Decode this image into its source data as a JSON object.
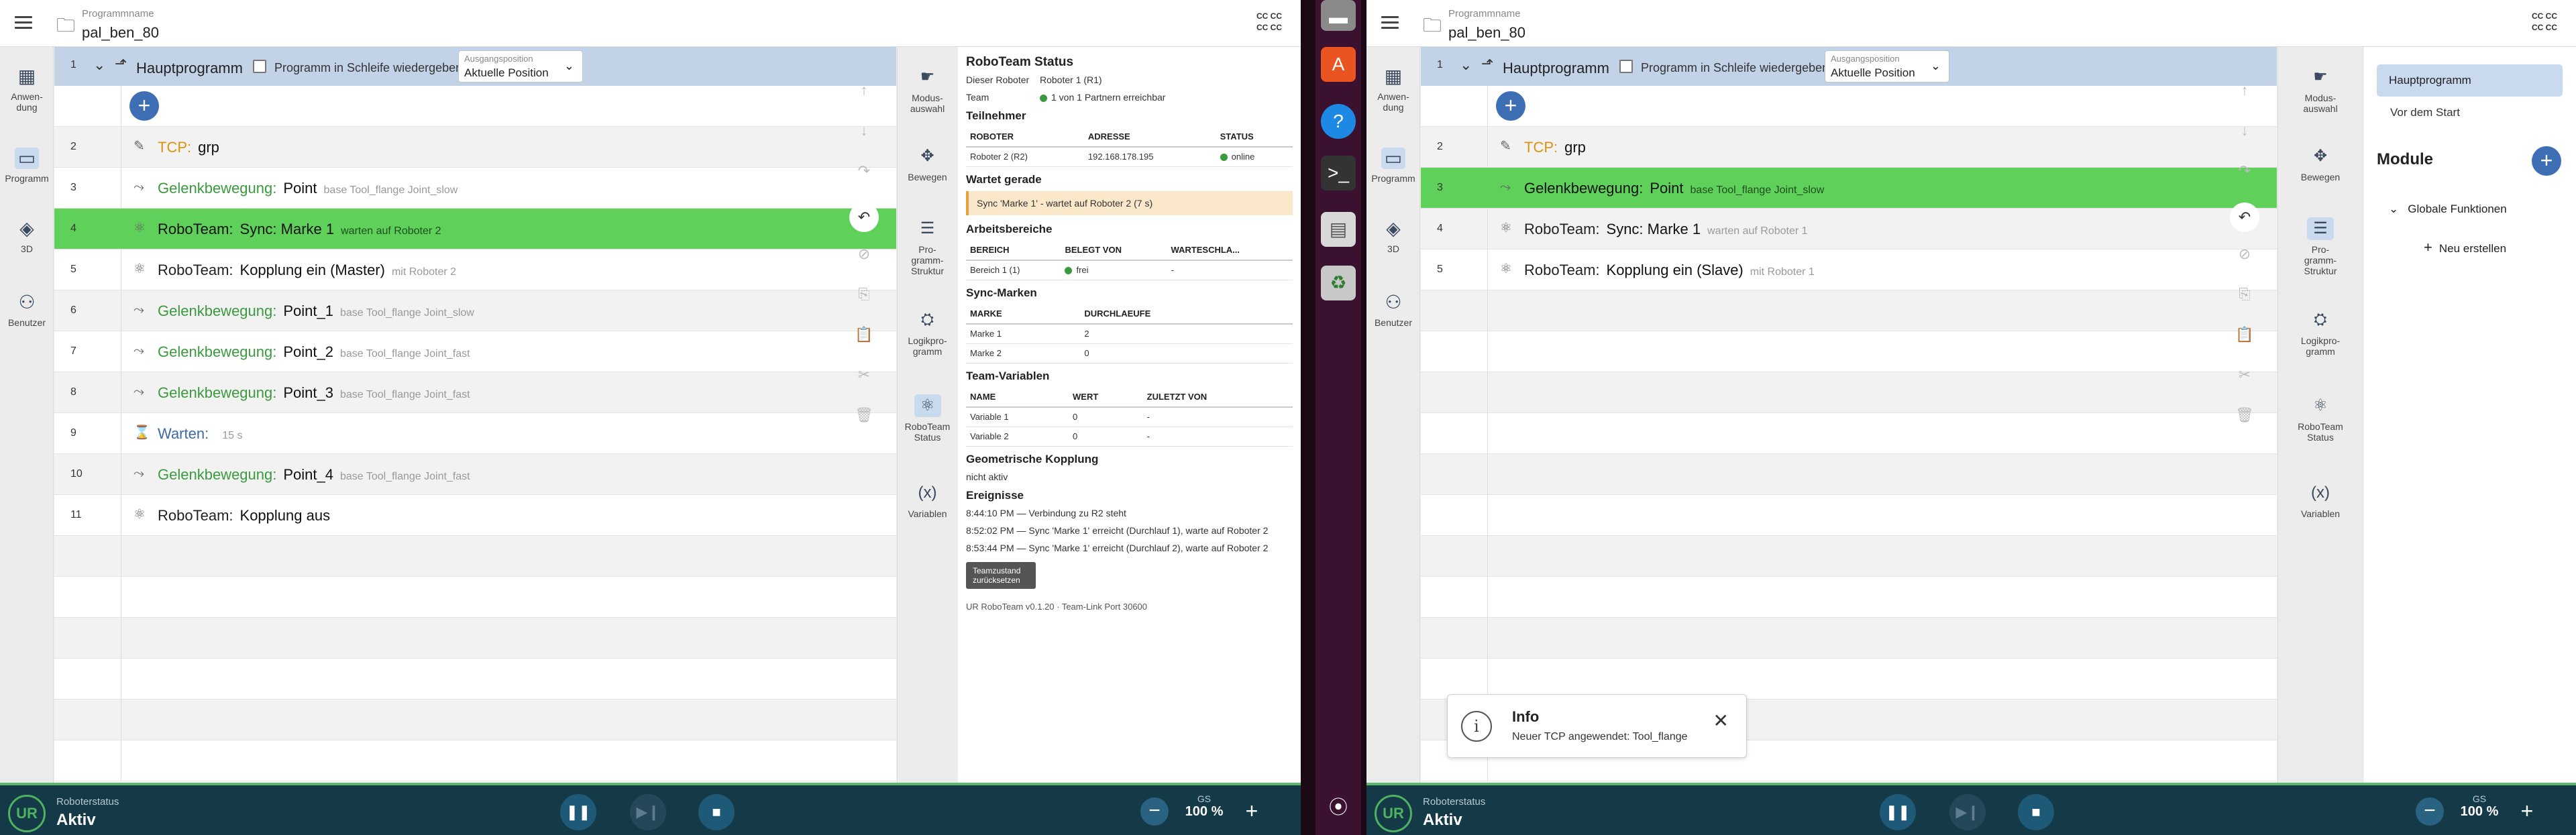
{
  "left": {
    "header": {
      "program_label": "Programmname",
      "program_name": "pal_ben_80",
      "cc": [
        "CC CC",
        "CC CC"
      ]
    },
    "nav": [
      {
        "label": "Anwen-\ndung",
        "icon": "apps-icon"
      },
      {
        "label": "Programm",
        "icon": "program-icon",
        "active": true
      },
      {
        "label": "3D",
        "icon": "cube-icon"
      },
      {
        "label": "Benutzer",
        "icon": "user-icon"
      }
    ],
    "program": {
      "num": "1",
      "title": "Hauptprogramm",
      "loop_label": "Programm in Schleife wiedergeben",
      "start_label": "Ausgangsposition",
      "start_value": "Aktuelle Position"
    },
    "rows": [
      {
        "n": "2",
        "kw": "TCP:",
        "name": "grp",
        "params": "",
        "color": "orange",
        "icon": "tcp-icon"
      },
      {
        "n": "3",
        "kw": "Gelenkbewegung:",
        "name": "Point",
        "params": "base   Tool_flange   Joint_slow",
        "color": "green",
        "icon": "move-icon"
      },
      {
        "n": "4",
        "kw": "RoboTeam:",
        "name": "Sync: Marke 1",
        "params": "warten auf Roboter 2",
        "color": "dark",
        "icon": "roboteam-icon",
        "hl": true
      },
      {
        "n": "5",
        "kw": "RoboTeam:",
        "name": "Kopplung ein (Master)",
        "params": "mit Roboter 2",
        "color": "dark",
        "icon": "roboteam-icon"
      },
      {
        "n": "6",
        "kw": "Gelenkbewegung:",
        "name": "Point_1",
        "params": "base   Tool_flange   Joint_slow",
        "color": "green",
        "icon": "move-icon"
      },
      {
        "n": "7",
        "kw": "Gelenkbewegung:",
        "name": "Point_2",
        "params": "base   Tool_flange   Joint_fast",
        "color": "green",
        "icon": "move-icon"
      },
      {
        "n": "8",
        "kw": "Gelenkbewegung:",
        "name": "Point_3",
        "params": "base   Tool_flange   Joint_fast",
        "color": "green",
        "icon": "move-icon"
      },
      {
        "n": "9",
        "kw": "Warten:",
        "name": "",
        "params": "15 s",
        "color": "blue",
        "icon": "hourglass-icon"
      },
      {
        "n": "10",
        "kw": "Gelenkbewegung:",
        "name": "Point_4",
        "params": "base   Tool_flange   Joint_fast",
        "color": "green",
        "icon": "move-icon"
      },
      {
        "n": "11",
        "kw": "RoboTeam:",
        "name": "Kopplung aus",
        "params": "",
        "color": "dark",
        "icon": "roboteam-icon"
      }
    ],
    "tools": [
      {
        "label": "Modus-\nauswahl",
        "icon": "mode-icon"
      },
      {
        "label": "Bewegen",
        "icon": "move-arrows-icon"
      },
      {
        "label": "Pro-\ngramm-\nStruktur",
        "icon": "structure-icon"
      },
      {
        "label": "Logikpro-\ngramm",
        "icon": "logic-icon"
      },
      {
        "label": "RoboTeam\nStatus",
        "icon": "roboteam-icon",
        "active": true
      },
      {
        "label": "Variablen",
        "icon": "variables-icon"
      }
    ],
    "status": {
      "title": "RoboTeam Status",
      "this_robot_label": "Dieser Roboter",
      "this_robot": "Roboter 1 (R1)",
      "team_label": "Team",
      "team_value": "1 von 1 Partnern erreichbar",
      "participants_title": "Teilnehmer",
      "participants_cols": [
        "ROBOTER",
        "ADRESSE",
        "STATUS"
      ],
      "participants": [
        [
          "Roboter 2 (R2)",
          "192.168.178.195",
          "online"
        ]
      ],
      "waiting_title": "Wartet gerade",
      "waiting_text": "Sync 'Marke 1' - wartet auf Roboter 2 (7 s)",
      "areas_title": "Arbeitsbereiche",
      "areas_cols": [
        "BEREICH",
        "BELEGT VON",
        "WARTESCHLA..."
      ],
      "areas": [
        [
          "Bereich 1 (1)",
          "frei",
          "-"
        ]
      ],
      "sync_title": "Sync-Marken",
      "sync_cols": [
        "MARKE",
        "DURCHLAEUFE"
      ],
      "sync": [
        [
          "Marke 1",
          "2"
        ],
        [
          "Marke 2",
          "0"
        ]
      ],
      "vars_title": "Team-Variablen",
      "vars_cols": [
        "NAME",
        "WERT",
        "ZULETZT VON"
      ],
      "vars": [
        [
          "Variable 1",
          "0",
          "-"
        ],
        [
          "Variable 2",
          "0",
          "-"
        ]
      ],
      "geo_title": "Geometrische Kopplung",
      "geo_value": "nicht aktiv",
      "events_title": "Ereignisse",
      "events": [
        "8:44:10 PM — Verbindung zu R2 steht",
        "8:52:02 PM — Sync 'Marke 1' erreicht (Durchlauf 1), warte auf Roboter 2",
        "8:53:44 PM — Sync 'Marke 1' erreicht (Durchlauf 2), warte auf Roboter 2"
      ],
      "reset_label": "Teamzustand zurücksetzen",
      "footer": "UR RoboTeam v0.1.20 · Team-Link Port 30600"
    },
    "bottom": {
      "status_label": "Roboterstatus",
      "status_value": "Aktiv",
      "speed_label": "GS",
      "speed_value": "100 %"
    }
  },
  "right": {
    "header": {
      "program_label": "Programmname",
      "program_name": "pal_ben_80",
      "cc": [
        "CC CC",
        "CC CC"
      ]
    },
    "nav": [
      {
        "label": "Anwen-\ndung",
        "icon": "apps-icon"
      },
      {
        "label": "Programm",
        "icon": "program-icon",
        "active": true
      },
      {
        "label": "3D",
        "icon": "cube-icon"
      },
      {
        "label": "Benutzer",
        "icon": "user-icon"
      }
    ],
    "program": {
      "num": "1",
      "title": "Hauptprogramm",
      "loop_label": "Programm in Schleife wiedergeben",
      "start_label": "Ausgangsposition",
      "start_value": "Aktuelle Position"
    },
    "rows": [
      {
        "n": "2",
        "kw": "TCP:",
        "name": "grp",
        "params": "",
        "color": "orange",
        "icon": "tcp-icon"
      },
      {
        "n": "3",
        "kw": "Gelenkbewegung:",
        "name": "Point",
        "params": "base   Tool_flange   Joint_slow",
        "color": "green",
        "icon": "move-icon",
        "hl": true
      },
      {
        "n": "4",
        "kw": "RoboTeam:",
        "name": "Sync: Marke 1",
        "params": "warten auf Roboter 1",
        "color": "dark",
        "icon": "roboteam-icon"
      },
      {
        "n": "5",
        "kw": "RoboTeam:",
        "name": "Kopplung ein (Slave)",
        "params": "mit Roboter 1",
        "color": "dark",
        "icon": "roboteam-icon"
      }
    ],
    "tools": [
      {
        "label": "Modus-\nauswahl",
        "icon": "mode-icon"
      },
      {
        "label": "Bewegen",
        "icon": "move-arrows-icon"
      },
      {
        "label": "Pro-\ngramm-\nStruktur",
        "icon": "structure-icon",
        "active": true
      },
      {
        "label": "Logikpro-\ngramm",
        "icon": "logic-icon"
      },
      {
        "label": "RoboTeam\nStatus",
        "icon": "roboteam-icon"
      },
      {
        "label": "Variablen",
        "icon": "variables-icon"
      }
    ],
    "structure": {
      "main": "Hauptprogramm",
      "before": "Vor dem Start",
      "modules_title": "Module",
      "global": "Globale Funktionen",
      "new": "Neu erstellen"
    },
    "toast": {
      "title": "Info",
      "message": "Neuer TCP angewendet: Tool_flange"
    },
    "bottom": {
      "status_label": "Roboterstatus",
      "status_value": "Aktiv",
      "speed_label": "GS",
      "speed_value": "100 %"
    }
  }
}
